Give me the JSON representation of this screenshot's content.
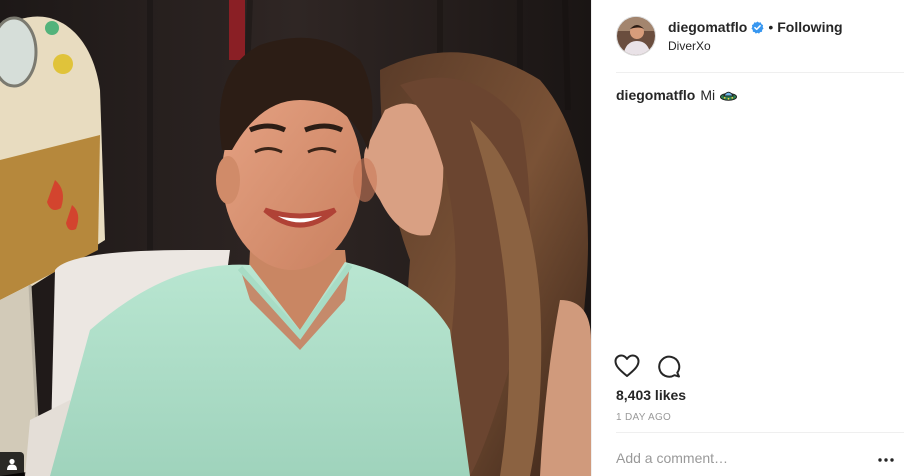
{
  "post": {
    "photo": {
      "tag_icon": "person-icon"
    },
    "header": {
      "username": "diegomatflo",
      "verified_icon": "verified-badge-icon",
      "separator": "•",
      "follow_label": "Following",
      "location": "DiverXo"
    },
    "caption": {
      "username": "diegomatflo",
      "text": "Mi",
      "emoji": "flying-saucer-emoji"
    },
    "actions": {
      "like_icon": "heart-icon",
      "comment_icon": "comment-icon"
    },
    "likes": "8,403 likes",
    "timestamp": "1 DAY AGO",
    "comment_box": {
      "placeholder": "Add a comment…",
      "value": ""
    },
    "more_icon": "more-options-icon"
  },
  "colors": {
    "text": "#262626",
    "muted": "#999999",
    "verified": "#3897f0",
    "divider": "#efefef"
  }
}
